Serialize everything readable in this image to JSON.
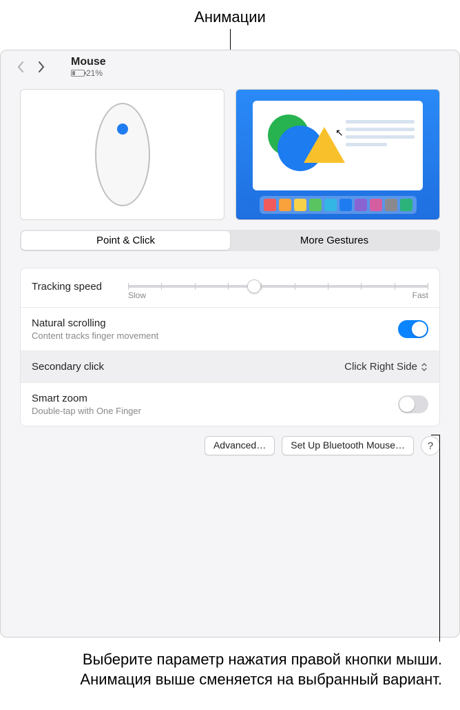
{
  "callouts": {
    "top": "Анимации",
    "bottom": "Выберите параметр нажатия правой кнопки мыши. Анимация выше сменяется на выбранный вариант."
  },
  "header": {
    "title": "Mouse",
    "battery_percent": "21%"
  },
  "tabs": {
    "point_click": "Point & Click",
    "more_gestures": "More Gestures"
  },
  "settings": {
    "tracking": {
      "label": "Tracking speed",
      "slow": "Slow",
      "fast": "Fast",
      "value_pct": 42
    },
    "natural_scrolling": {
      "label": "Natural scrolling",
      "sub": "Content tracks finger movement",
      "on": true
    },
    "secondary_click": {
      "label": "Secondary click",
      "value": "Click Right Side"
    },
    "smart_zoom": {
      "label": "Smart zoom",
      "sub": "Double-tap with One Finger",
      "on": false
    }
  },
  "footer": {
    "advanced": "Advanced…",
    "setup_bt": "Set Up Bluetooth Mouse…",
    "help": "?"
  },
  "dock_colors": [
    "#f25b5b",
    "#f9a23b",
    "#f7d14a",
    "#5ac460",
    "#34b6e4",
    "#1f7cf0",
    "#8a63d2",
    "#d45fa0",
    "#8a8a8e",
    "#2bb37a"
  ]
}
